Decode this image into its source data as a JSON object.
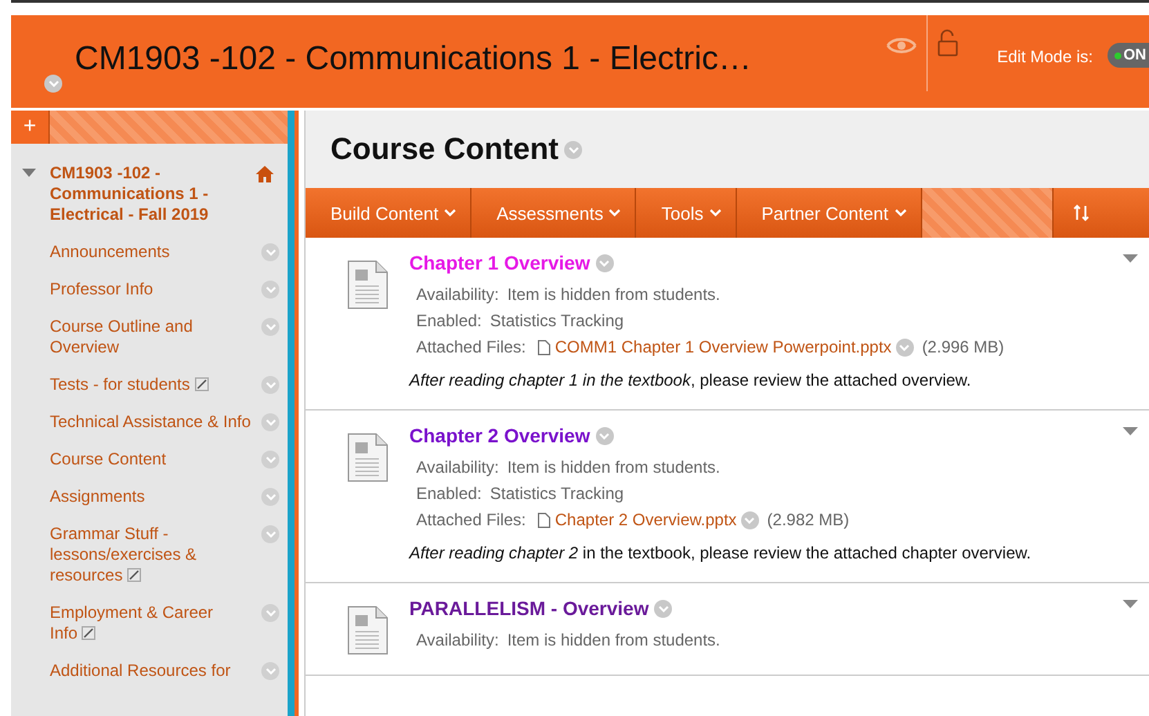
{
  "header": {
    "title": "CM1903 -102 - Communications 1 - Electric…",
    "edit_mode_label": "Edit Mode is:",
    "edit_mode": {
      "label": "ON",
      "on": true
    }
  },
  "sidebar": {
    "add_button": "+",
    "course": {
      "title": "CM1903 -102 - Communications 1 - Electrical - Fall 2019",
      "expanded": true
    },
    "items": [
      {
        "label": "Announcements",
        "hidden": false
      },
      {
        "label": "Professor Info",
        "hidden": false
      },
      {
        "label": "Course Outline and Overview",
        "hidden": false
      },
      {
        "label": "Tests - for students",
        "hidden": true
      },
      {
        "label": "Technical Assistance & Info",
        "hidden": false
      },
      {
        "label": "Course Content",
        "hidden": false
      },
      {
        "label": "Assignments",
        "hidden": false
      },
      {
        "label": "Grammar Stuff - lessons/exercises & resources",
        "hidden": true
      },
      {
        "label": "Employment & Career Info",
        "hidden": true
      },
      {
        "label": "Additional Resources for",
        "hidden": false
      }
    ]
  },
  "page": {
    "title": "Course Content",
    "toolbar": [
      "Build Content",
      "Assessments",
      "Tools",
      "Partner Content"
    ],
    "items": [
      {
        "title": "Chapter 1 Overview",
        "color": "#e619e6",
        "availability_label": "Availability:",
        "availability": "Item is hidden from students.",
        "enabled_label": "Enabled:",
        "enabled": "Statistics Tracking",
        "files_label": "Attached Files:",
        "file": "COMM1 Chapter 1 Overview Powerpoint.pptx",
        "size": "(2.996 MB)",
        "description": "*After reading chapter 1 in the textbook*, please review the attached overview."
      },
      {
        "title": "Chapter 2 Overview",
        "color": "#7a12cc",
        "availability_label": "Availability:",
        "availability": "Item is hidden from students.",
        "enabled_label": "Enabled:",
        "enabled": "Statistics Tracking",
        "files_label": "Attached Files:",
        "file": "Chapter 2 Overview.pptx",
        "size": "(2.982 MB)",
        "description": "*After reading chapter 2* in the textbook, please review the attached chapter overview."
      },
      {
        "title": "PARALLELISM - Overview",
        "color": "#6a1a9a",
        "availability_label": "Availability:",
        "availability": "Item is hidden from students."
      }
    ]
  }
}
